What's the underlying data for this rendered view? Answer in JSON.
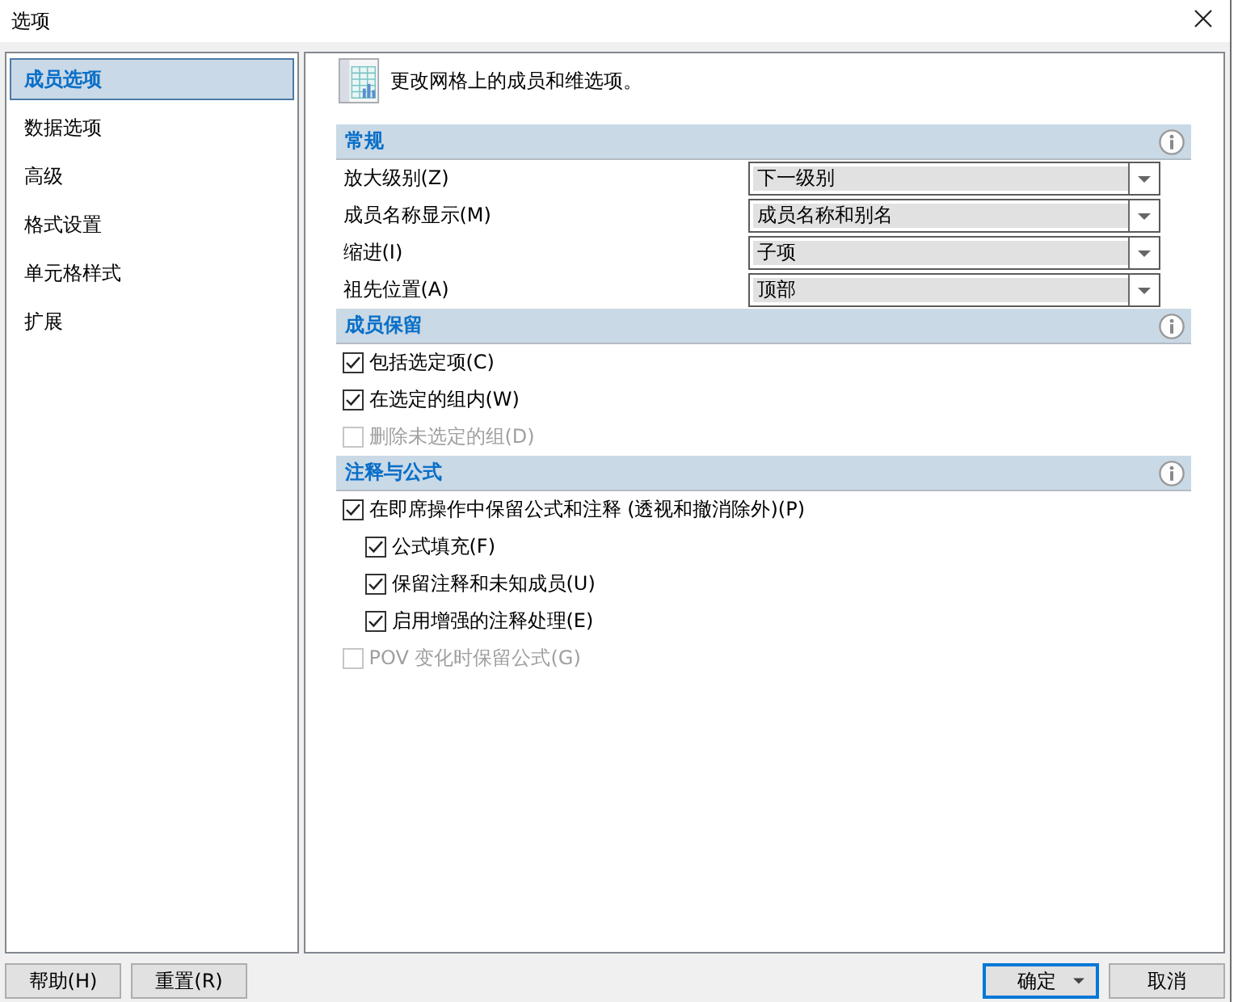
{
  "window": {
    "title": "选项"
  },
  "sidebar": {
    "items": [
      {
        "label": "成员选项",
        "selected": true
      },
      {
        "label": "数据选项",
        "selected": false
      },
      {
        "label": "高级",
        "selected": false
      },
      {
        "label": "格式设置",
        "selected": false
      },
      {
        "label": "单元格样式",
        "selected": false
      },
      {
        "label": "扩展",
        "selected": false
      }
    ]
  },
  "description": "更改网格上的成员和维选项。",
  "sections": [
    {
      "title": "常规",
      "rows": [
        {
          "kind": "dropdown",
          "label": "放大级别(Z)",
          "value": "下一级别"
        },
        {
          "kind": "dropdown",
          "label": "成员名称显示(M)",
          "value": "成员名称和别名"
        },
        {
          "kind": "dropdown",
          "label": "缩进(I)",
          "value": "子项"
        },
        {
          "kind": "dropdown",
          "label": "祖先位置(A)",
          "value": "顶部"
        }
      ]
    },
    {
      "title": "成员保留",
      "rows": [
        {
          "kind": "checkbox",
          "label": "包括选定项(C)",
          "checked": true,
          "disabled": false
        },
        {
          "kind": "checkbox",
          "label": "在选定的组内(W)",
          "checked": true,
          "disabled": false
        },
        {
          "kind": "checkbox",
          "label": "删除未选定的组(D)",
          "checked": false,
          "disabled": true
        }
      ]
    },
    {
      "title": "注释与公式",
      "rows": [
        {
          "kind": "checkbox",
          "label": "在即席操作中保留公式和注释 (透视和撤消除外)(P)",
          "checked": true,
          "disabled": false,
          "children": [
            {
              "kind": "checkbox",
              "label": "公式填充(F)",
              "checked": true,
              "disabled": false
            },
            {
              "kind": "checkbox",
              "label": "保留注释和未知成员(U)",
              "checked": true,
              "disabled": false
            },
            {
              "kind": "checkbox",
              "label": "启用增强的注释处理(E)",
              "checked": true,
              "disabled": false
            }
          ]
        },
        {
          "kind": "checkbox",
          "label": "POV 变化时保留公式(G)",
          "checked": false,
          "disabled": true
        }
      ]
    }
  ],
  "footer": {
    "left_buttons": [
      {
        "label": "帮助(H)",
        "kind": "plain",
        "default": false
      },
      {
        "label": "重置(R)",
        "kind": "plain",
        "default": false
      }
    ],
    "right_buttons": [
      {
        "label": "确定",
        "kind": "split",
        "default": true
      },
      {
        "label": "取消",
        "kind": "plain",
        "default": false
      }
    ]
  }
}
